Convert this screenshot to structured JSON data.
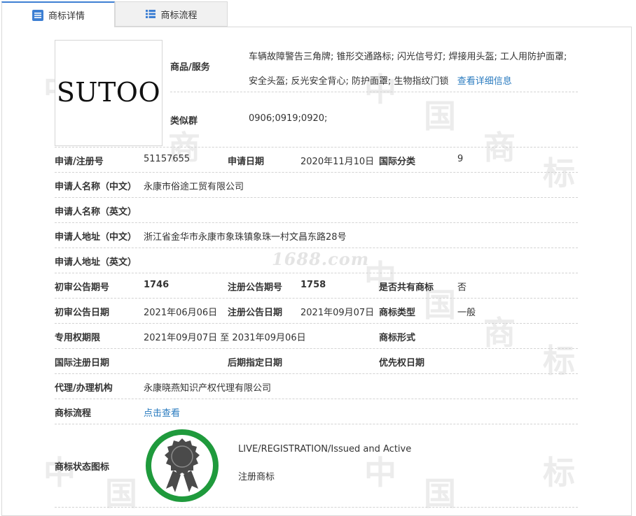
{
  "tabs": {
    "detail": "商标详情",
    "flow": "商标流程"
  },
  "logo": {
    "text": "SUTOO"
  },
  "goods": {
    "label": "商品/服务",
    "text": "车辆故障警告三角牌; 锥形交通路标; 闪光信号灯; 焊接用头盔; 工人用防护面罩; 安全头盔; 反光安全背心; 防护面罩; 生物指纹门锁",
    "link": "查看详细信息"
  },
  "similar_group": {
    "label": "类似群",
    "value": "0906;0919;0920;"
  },
  "fields": {
    "reg_no_label": "申请/注册号",
    "reg_no": "51157655",
    "apply_date_label": "申请日期",
    "apply_date": "2020年11月10日",
    "intl_class_label": "国际分类",
    "intl_class": "9",
    "applicant_cn_label": "申请人名称（中文）",
    "applicant_cn": "永康市俗途工贸有限公司",
    "applicant_en_label": "申请人名称（英文）",
    "applicant_en": "",
    "address_cn_label": "申请人地址（中文）",
    "address_cn": "浙江省金华市永康市象珠镇象珠一村文昌东路28号",
    "address_en_label": "申请人地址（英文）",
    "address_en": "",
    "prelim_no_label": "初审公告期号",
    "prelim_no": "1746",
    "reg_pub_no_label": "注册公告期号",
    "reg_pub_no": "1758",
    "shared_label": "是否共有商标",
    "shared": "否",
    "prelim_date_label": "初审公告日期",
    "prelim_date": "2021年06月06日",
    "reg_pub_date_label": "注册公告日期",
    "reg_pub_date": "2021年09月07日",
    "mark_type_label": "商标类型",
    "mark_type": "一般",
    "exclusive_label": "专用权期限",
    "exclusive": "2021年09月07日 至 2031年09月06日",
    "mark_form_label": "商标形式",
    "mark_form": "",
    "intl_reg_date_label": "国际注册日期",
    "intl_reg_date": "",
    "later_date_label": "后期指定日期",
    "later_date": "",
    "priority_date_label": "优先权日期",
    "priority_date": "",
    "agent_label": "代理/办理机构",
    "agent": "永康晓燕知识产权代理有限公司",
    "flow_label": "商标流程",
    "flow_link": "点击查看",
    "status_icon_label": "商标状态图标",
    "status_en": "LIVE/REGISTRATION/Issued and Active",
    "status_cn": "注册商标"
  },
  "watermark": {
    "site": "1688.com"
  },
  "colors": {
    "accent": "#3d7fd3",
    "link": "#2a7bbf",
    "badge_ring": "#1f9a3c",
    "badge_inner": "#4a4a4a"
  }
}
